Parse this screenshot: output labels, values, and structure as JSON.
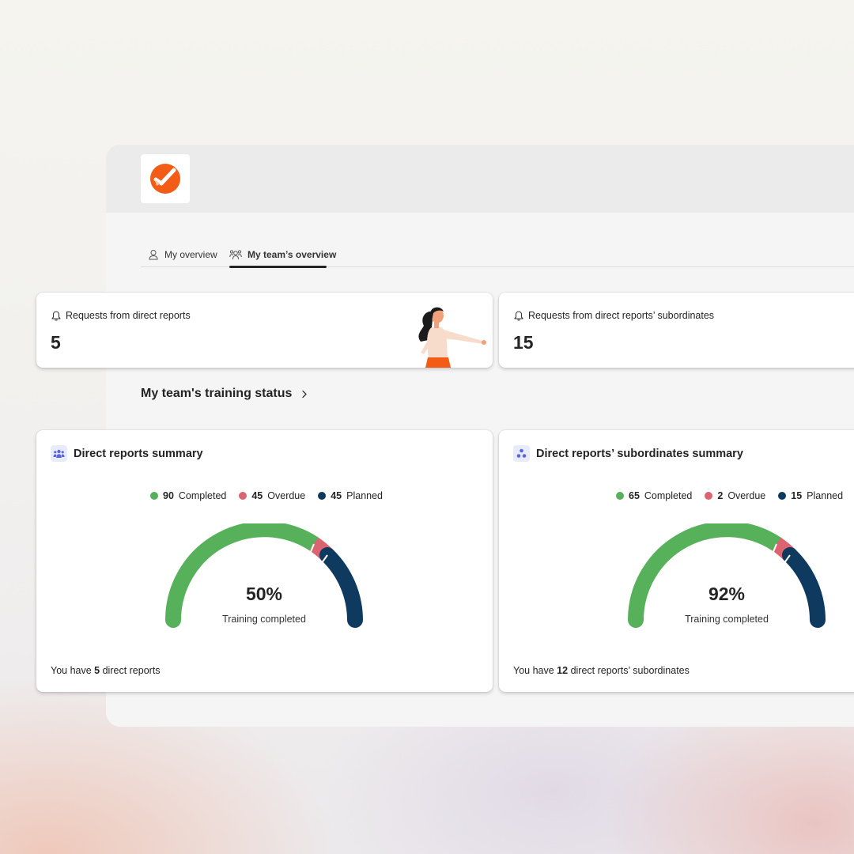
{
  "tabs": [
    {
      "label": "My overview",
      "icon": "person-icon",
      "active": false
    },
    {
      "label": "My team’s overview",
      "icon": "people-team-icon",
      "active": true
    }
  ],
  "requests": [
    {
      "label": "Requests from direct reports",
      "value": "5",
      "icon": "bell-icon"
    },
    {
      "label": "Requests from direct reports’ subordinates",
      "value": "15",
      "icon": "bell-icon"
    }
  ],
  "section": {
    "title": "My team's training status",
    "icon": "chevron-right-icon"
  },
  "colors": {
    "completed": "#56b15a",
    "overdue": "#dc6470",
    "planned": "#0f3a5f",
    "brand": "#f25c16"
  },
  "summaries": [
    {
      "title": "Direct reports summary",
      "icon": "team-icon",
      "legend": [
        {
          "value": "90",
          "label": "Completed"
        },
        {
          "value": "45",
          "label": "Overdue"
        },
        {
          "value": "45",
          "label": "Planned"
        }
      ],
      "percent": "50%",
      "caption": "Training completed",
      "footer": {
        "prefix": "You have",
        "count": "5",
        "suffix": "direct reports"
      }
    },
    {
      "title": "Direct reports’ subordinates summary",
      "icon": "org-chart-icon",
      "legend": [
        {
          "value": "65",
          "label": "Completed"
        },
        {
          "value": "2",
          "label": "Overdue"
        },
        {
          "value": "15",
          "label": "Planned"
        }
      ],
      "percent": "92%",
      "caption": "Training completed",
      "footer": {
        "prefix": "You have",
        "count": "12",
        "suffix": "direct reports’ subordinates"
      }
    }
  ]
}
